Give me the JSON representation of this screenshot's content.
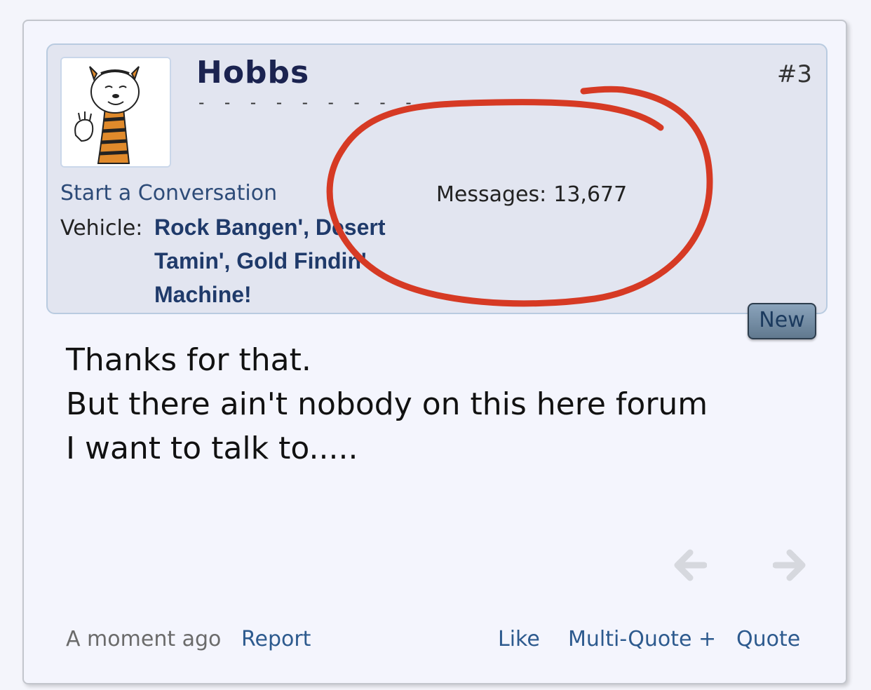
{
  "post": {
    "username": "Hobbs",
    "user_title": "- - - - - - - - - -",
    "post_number": "#3",
    "start_conversation": "Start a Conversation",
    "vehicle_label": "Vehicle:",
    "vehicle_value": "Rock Bangen', Desert Tamin', Gold Findin' Machine!",
    "messages_label": "Messages:",
    "messages_count": "13,677",
    "new_badge": "New",
    "body_lines": [
      "Thanks for that.",
      "But there ain't nobody on this here forum",
      "I want to talk to....."
    ]
  },
  "icons": {
    "avatar": "tiger-avatar",
    "prev": "arrow-left-icon",
    "next": "arrow-right-icon"
  },
  "footer": {
    "timestamp": "A moment ago",
    "report": "Report",
    "like": "Like",
    "multi_quote": "Multi-Quote +",
    "quote": "Quote"
  },
  "colors": {
    "annotation_circle": "#d63a24",
    "link": "#2d5a8e",
    "username": "#1b2350"
  }
}
